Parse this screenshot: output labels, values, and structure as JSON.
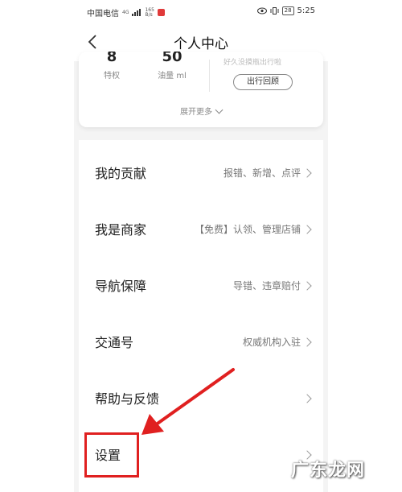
{
  "status_bar": {
    "carrier": "中国电信",
    "net_top": "4G",
    "speed": "165",
    "speed_unit": "B/s",
    "battery": "28",
    "time": "5:25"
  },
  "header": {
    "title": "个人中心"
  },
  "stats": {
    "items": [
      {
        "value": "8",
        "label": "特权"
      },
      {
        "value": "50",
        "label": "油量 ml"
      }
    ],
    "trip_hint": "好久没摸瓶出行啦",
    "trip_review_label": "出行回顾",
    "expand_label": "展开更多"
  },
  "menu": {
    "items": [
      {
        "label": "我的贡献",
        "desc": "报错、新增、点评"
      },
      {
        "label": "我是商家",
        "desc": "【免费】认领、管理店铺"
      },
      {
        "label": "导航保障",
        "desc": "导错、违章赔付"
      },
      {
        "label": "交通号",
        "desc": "权威机构入驻"
      },
      {
        "label": "帮助与反馈",
        "desc": ""
      },
      {
        "label": "设置",
        "desc": ""
      }
    ]
  },
  "watermark": "广东龙网",
  "colors": {
    "annotation": "#e02020",
    "background": "#f4f4f4"
  }
}
